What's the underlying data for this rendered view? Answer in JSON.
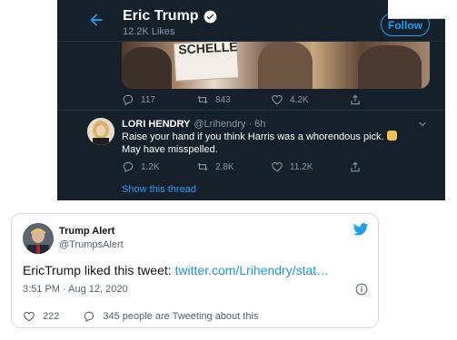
{
  "dark_screenshot": {
    "profile": {
      "name": "Eric Trump",
      "likes_label": "12.2K Likes",
      "follow_label": "Follow"
    },
    "photo": {
      "sign_text": "SCHELLE"
    },
    "tweet_actions": {
      "replies": "117",
      "retweets": "843",
      "likes": "4.2K"
    },
    "reply": {
      "name": "LORI HENDRY",
      "handle_time": "@Lrihendry · 6h",
      "line1": "Raise your hand if you think Harris was a whorendous pick.",
      "line2": "May have misspelled.",
      "actions": {
        "replies": "1.2K",
        "retweets": "2.8K",
        "likes": "11.2K"
      }
    },
    "show_thread": "Show this thread"
  },
  "embedded_tweet": {
    "name": "Trump Alert",
    "handle": "@TrumpsAlert",
    "text_prefix": "EricTrump liked this tweet: ",
    "link_text": "twitter.com/Lrihendry/stat…",
    "timestamp": "3:51 PM · Aug 12, 2020",
    "likes": "222",
    "tweeting_about": "345 people are Tweeting about this"
  },
  "colors": {
    "dark_bg": "#15202b",
    "twitter_blue": "#1da1f2",
    "muted_gray": "#8899a6"
  }
}
